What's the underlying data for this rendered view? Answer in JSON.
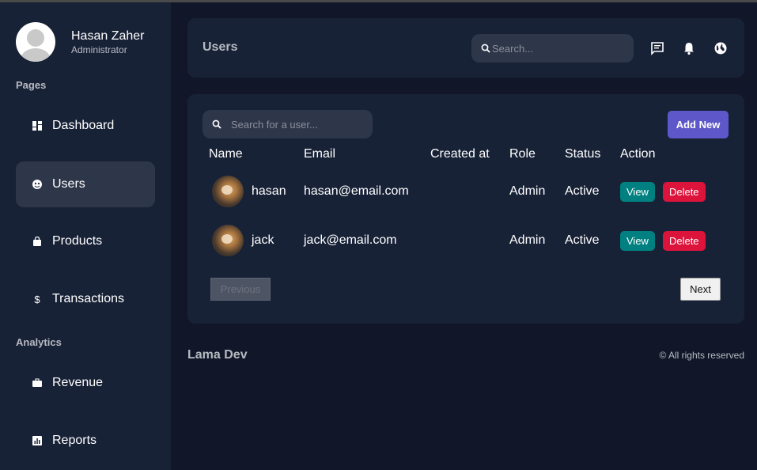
{
  "sidebar": {
    "user": {
      "name": "Hasan Zaher",
      "role": "Administrator"
    },
    "sections": [
      {
        "title": "Pages",
        "items": [
          {
            "label": "Dashboard",
            "icon": "dashboard-icon",
            "active": false
          },
          {
            "label": "Users",
            "icon": "users-icon",
            "active": true
          },
          {
            "label": "Products",
            "icon": "shopping-bag-icon",
            "active": false
          },
          {
            "label": "Transactions",
            "icon": "dollar-icon",
            "active": false
          }
        ]
      },
      {
        "title": "Analytics",
        "items": [
          {
            "label": "Revenue",
            "icon": "briefcase-icon",
            "active": false
          },
          {
            "label": "Reports",
            "icon": "bar-chart-icon",
            "active": false
          }
        ]
      }
    ]
  },
  "navbar": {
    "title": "Users",
    "search_placeholder": "Search...",
    "icons": [
      "messages-icon",
      "notifications-icon",
      "globe-icon"
    ]
  },
  "users": {
    "search_placeholder": "Search for a user...",
    "add_label": "Add New",
    "columns": [
      "Name",
      "Email",
      "Created at",
      "Role",
      "Status",
      "Action"
    ],
    "rows": [
      {
        "name": "hasan",
        "email": "hasan@email.com",
        "created": "",
        "role": "Admin",
        "status": "Active"
      },
      {
        "name": "jack",
        "email": "jack@email.com",
        "created": "",
        "role": "Admin",
        "status": "Active"
      }
    ],
    "view_label": "View",
    "delete_label": "Delete"
  },
  "pagination": {
    "previous_label": "Previous",
    "next_label": "Next",
    "previous_disabled": true
  },
  "footer": {
    "logo": "Lama Dev",
    "copyright": "© All rights reserved"
  },
  "colors": {
    "background": "#111729",
    "panel": "#182237",
    "panel_light": "#2e374a",
    "accent": "#5d57c9",
    "view": "#008080",
    "delete": "#dc143c"
  }
}
